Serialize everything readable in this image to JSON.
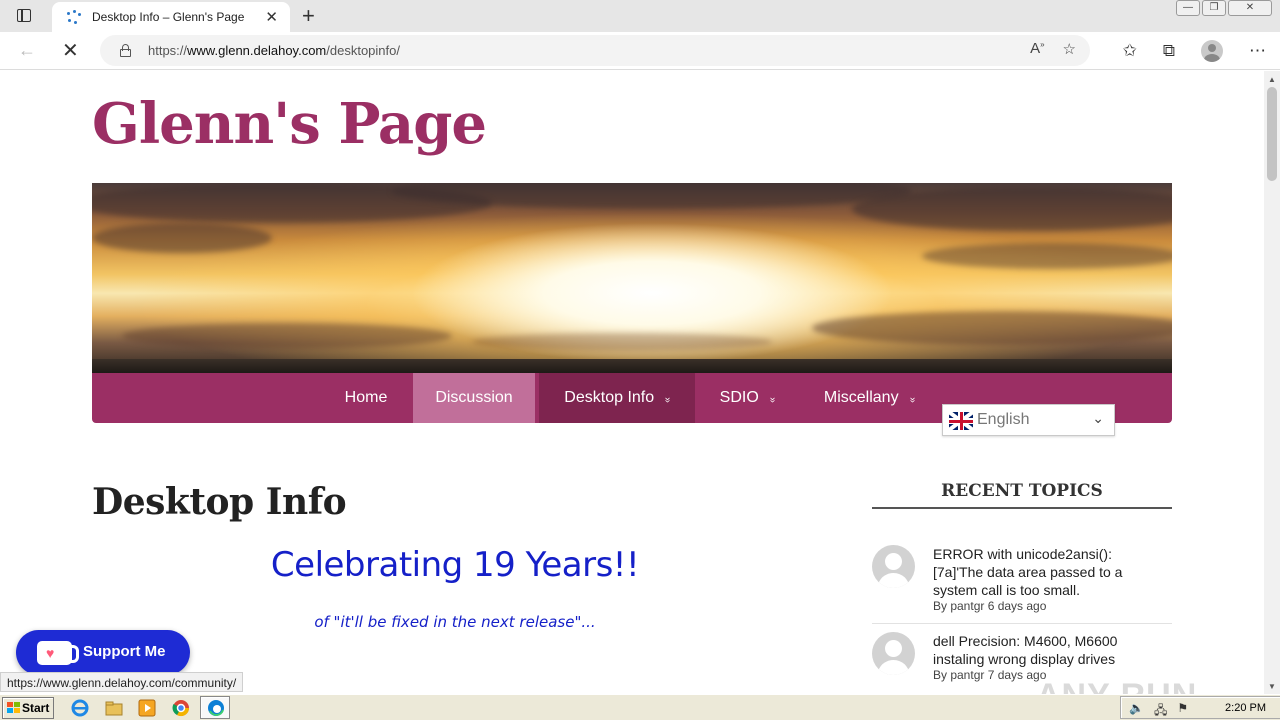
{
  "browser": {
    "tab_title": "Desktop Info – Glenn's Page",
    "tab_close": "✕",
    "new_tab": "+",
    "url_prefix": "https://",
    "url_host": "www.glenn.delahoy.com",
    "url_path": "/desktopinfo/",
    "window_controls": [
      "—",
      "❐",
      "✕"
    ]
  },
  "site": {
    "title": "Glenn's Page"
  },
  "nav": {
    "items": [
      {
        "label": "Home",
        "has_submenu": false
      },
      {
        "label": "Discussion",
        "has_submenu": false
      },
      {
        "label": "Desktop Info",
        "has_submenu": true
      },
      {
        "label": "SDIO",
        "has_submenu": true
      },
      {
        "label": "Miscellany",
        "has_submenu": true
      }
    ],
    "chevron": "»"
  },
  "language": {
    "selected": "English",
    "flag": "uk-flag-icon"
  },
  "content": {
    "heading": "Desktop Info",
    "celebrate": "Celebrating 19 Years!!",
    "tagline": "of \"it'll be fixed in the next release\"..."
  },
  "sidebar": {
    "heading": "RECENT TOPICS",
    "topics": [
      {
        "title": "ERROR with unicode2ansi(): [7a]'The data area passed to a system call is too small.",
        "meta": "By pantgr 6 days ago"
      },
      {
        "title": "dell Precision: M4600, M6600 instaling wrong display drives",
        "meta": "By pantgr 7 days ago"
      }
    ]
  },
  "support": {
    "label": "Support Me"
  },
  "status_bar": {
    "url": "https://www.glenn.delahoy.com/community/"
  },
  "watermark": "ANY RUN",
  "taskbar": {
    "start_label": "Start",
    "clock": "2:20 PM"
  },
  "colors": {
    "brand": "#9b2f64",
    "nav_active": "#c16f9a",
    "nav_current": "#7e244f",
    "celebrate_text": "#1520c8",
    "support_button": "#1e2bd4"
  }
}
